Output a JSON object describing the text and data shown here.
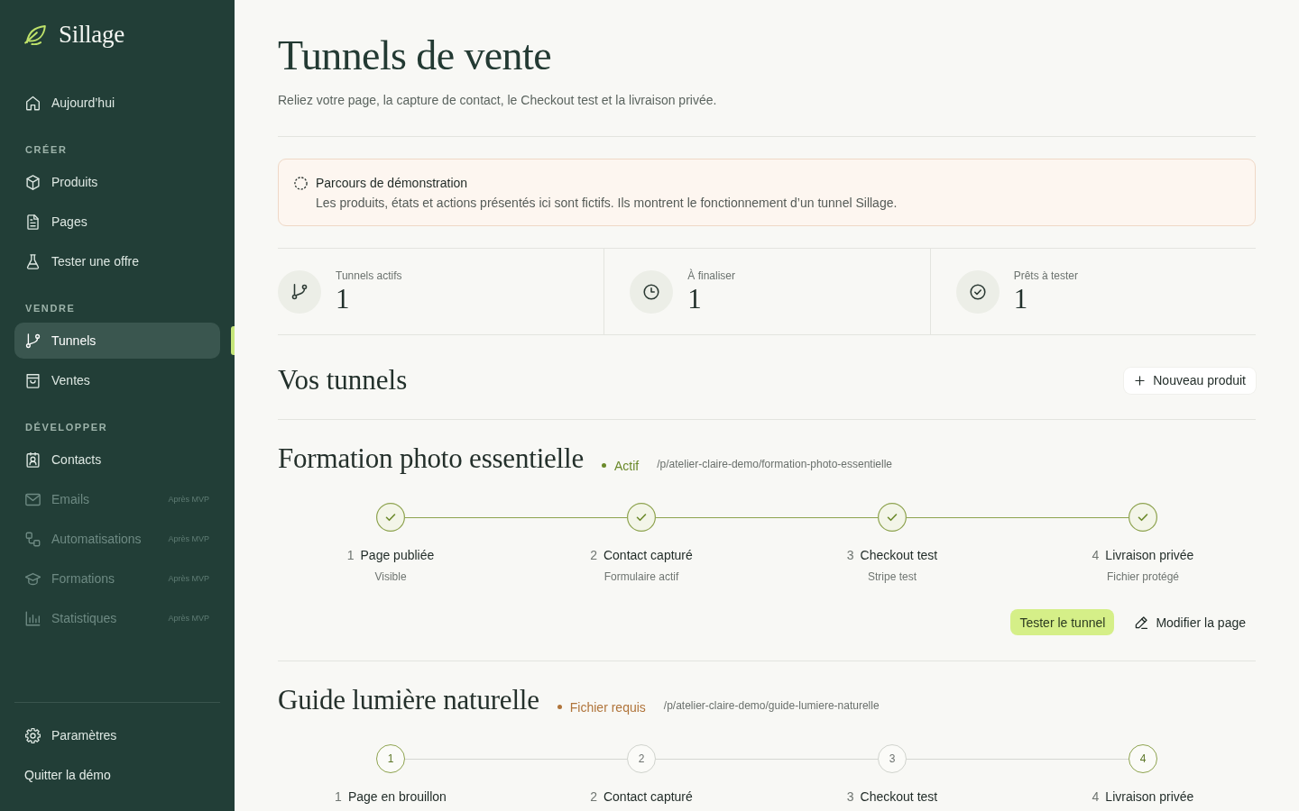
{
  "sidebar": {
    "brand": "Sillage",
    "sections": [
      {
        "items": [
          {
            "label": "Aujourd’hui",
            "selected": false,
            "disabled": false
          }
        ]
      },
      {
        "heading": "CRÉER",
        "items": [
          {
            "label": "Produits",
            "selected": false,
            "disabled": false
          },
          {
            "label": "Pages",
            "selected": false,
            "disabled": false
          },
          {
            "label": "Tester une offre",
            "selected": false,
            "disabled": false
          }
        ]
      },
      {
        "heading": "VENDRE",
        "items": [
          {
            "label": "Tunnels",
            "selected": true,
            "disabled": false
          },
          {
            "label": "Ventes",
            "selected": false,
            "disabled": false
          }
        ]
      },
      {
        "heading": "DÉVELOPPER",
        "items": [
          {
            "label": "Contacts",
            "selected": false,
            "disabled": false
          },
          {
            "label": "Emails",
            "selected": false,
            "disabled": true,
            "badge": "Après MVP"
          },
          {
            "label": "Automatisations",
            "selected": false,
            "disabled": true,
            "badge": "Après MVP"
          },
          {
            "label": "Formations",
            "selected": false,
            "disabled": true,
            "badge": "Après MVP"
          },
          {
            "label": "Statistiques",
            "selected": false,
            "disabled": true,
            "badge": "Après MVP"
          }
        ]
      }
    ],
    "footer_items": [
      {
        "label": "Paramètres",
        "selected": false,
        "disabled": false
      }
    ],
    "exit_link": "Quitter la démo"
  },
  "header": {
    "title": "Tunnels de vente",
    "subtitle": "Reliez votre page, la capture de contact, le Checkout test et la livraison privée."
  },
  "notice": {
    "title": "Parcours de démonstration",
    "text": "Les produits, états et actions présentés ici sont fictifs. Ils montrent le fonctionnement d’un tunnel Sillage."
  },
  "stats": [
    {
      "label": "Tunnels actifs",
      "value": "1"
    },
    {
      "label": "À finaliser",
      "value": "1"
    },
    {
      "label": "Prêts à tester",
      "value": "1"
    }
  ],
  "tunnels_header": {
    "title": "Vos tunnels",
    "button": "Nouveau produit"
  },
  "tunnels": [
    {
      "name": "Formation photo essentielle",
      "status": {
        "label": "Actif",
        "color": "#6b8a2b"
      },
      "url": "/p/atelier-claire-demo/formation-photo-essentielle",
      "steps": [
        {
          "done": true,
          "highlighted": false,
          "number": "1",
          "title": "Page publiée",
          "detail": "Visible"
        },
        {
          "done": true,
          "highlighted": false,
          "number": "2",
          "title": "Contact capturé",
          "detail": "Formulaire actif"
        },
        {
          "done": true,
          "highlighted": false,
          "number": "3",
          "title": "Checkout test",
          "detail": "Stripe test"
        },
        {
          "done": true,
          "highlighted": false,
          "number": "4",
          "title": "Livraison privée",
          "detail": "Fichier protégé"
        }
      ],
      "actions": [
        {
          "kind": "primary",
          "label": "Tester le tunnel"
        },
        {
          "kind": "edit",
          "label": "Modifier la page"
        }
      ]
    },
    {
      "name": "Guide lumière naturelle",
      "status": {
        "label": "Fichier requis",
        "color": "#b0743a"
      },
      "url": "/p/atelier-claire-demo/guide-lumiere-naturelle",
      "steps": [
        {
          "done": false,
          "highlighted": true,
          "marker": "1",
          "number": "1",
          "title": "Page en brouillon"
        },
        {
          "done": false,
          "highlighted": false,
          "marker": "2",
          "number": "2",
          "title": "Contact capturé"
        },
        {
          "done": false,
          "highlighted": false,
          "marker": "3",
          "number": "3",
          "title": "Checkout test"
        },
        {
          "done": false,
          "highlighted": true,
          "marker": "4",
          "number": "4",
          "title": "Livraison privée"
        }
      ]
    }
  ]
}
